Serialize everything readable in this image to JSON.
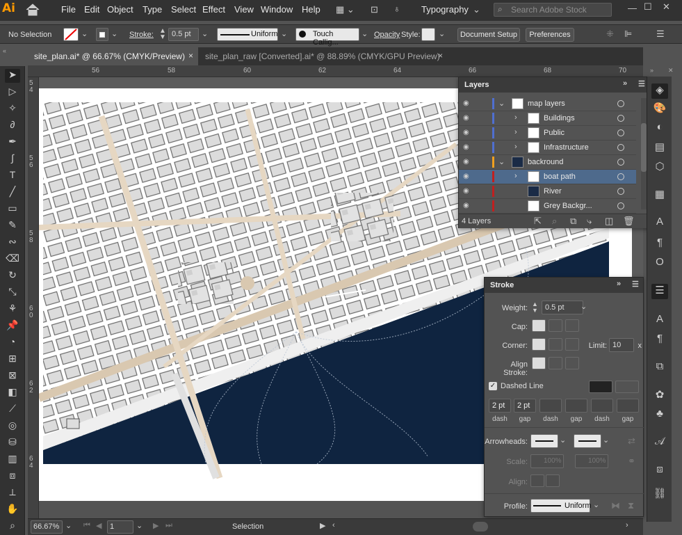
{
  "app": {
    "logo_text": "Ai"
  },
  "menu": [
    "File",
    "Edit",
    "Object",
    "Type",
    "Select",
    "Effect",
    "View",
    "Window",
    "Help"
  ],
  "workspace": {
    "label": "Typography"
  },
  "search": {
    "placeholder": "Search Adobe Stock"
  },
  "control": {
    "selection": "No Selection",
    "stroke_label": "Stroke:",
    "stroke_value": "0.5 pt",
    "profile": "Uniform",
    "brush": "Touch Callig...",
    "opacity_label": "Opacity",
    "style_label": "Style:",
    "doc_setup": "Document Setup",
    "preferences": "Preferences"
  },
  "tabs": [
    {
      "label": "site_plan.ai* @ 66.67% (CMYK/Preview)",
      "close": "×"
    },
    {
      "label": "site_plan_raw [Converted].ai* @ 88.89% (CMYK/GPU Preview)",
      "close": "×"
    }
  ],
  "ruler": {
    "h": [
      "56",
      "58",
      "60",
      "62",
      "64",
      "66",
      "68",
      "70"
    ],
    "v": [
      "5 4",
      "5 6",
      "5 8",
      "6 0",
      "6 2",
      "6 4"
    ]
  },
  "layers": {
    "title": "Layers",
    "rows": [
      {
        "name": "map layers",
        "color": "#4f6fd0",
        "level": 0
      },
      {
        "name": "Buildings",
        "color": "#4f6fd0",
        "level": 1
      },
      {
        "name": "Public",
        "color": "#4f6fd0",
        "level": 1
      },
      {
        "name": "Infrastructure",
        "color": "#4f6fd0",
        "level": 1
      },
      {
        "name": "backround",
        "color": "#f0a020",
        "level": 0
      },
      {
        "name": "boat path",
        "color": "#c02020",
        "level": 1
      },
      {
        "name": "River",
        "color": "#c02020",
        "level": 1
      },
      {
        "name": "Grey Backgr...",
        "color": "#c02020",
        "level": 1
      }
    ],
    "count": "4 Layers"
  },
  "stroke": {
    "title": "Stroke",
    "weight_label": "Weight:",
    "weight": "0.5 pt",
    "cap_label": "Cap:",
    "corner_label": "Corner:",
    "limit_label": "Limit:",
    "limit": "10",
    "limit_unit": "x",
    "align_label": "Align Stroke:",
    "dashed_label": "Dashed Line",
    "dashes": [
      "2 pt",
      "2 pt",
      "",
      "",
      "",
      ""
    ],
    "dash_labels": [
      "dash",
      "gap",
      "dash",
      "gap",
      "dash",
      "gap"
    ],
    "arrowheads_label": "Arrowheads:",
    "scale_label": "Scale:",
    "scale1": "100%",
    "scale2": "100%",
    "align2_label": "Align:",
    "profile_label": "Profile:",
    "profile": "Uniform"
  },
  "status": {
    "zoom": "66.67%",
    "artboard": "1",
    "tool": "Selection"
  }
}
